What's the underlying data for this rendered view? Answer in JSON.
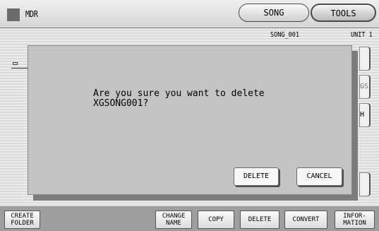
{
  "header": {
    "app_title": "MDR",
    "tabs": [
      {
        "label": "SONG"
      },
      {
        "label": "TOOLS"
      }
    ]
  },
  "info": {
    "song_name": "SONG_001",
    "unit": "UNIT 1"
  },
  "side_buttons": {
    "middle_label": "GS",
    "lower_label": "H"
  },
  "dialog": {
    "message": "Are you sure you want to delete\nXGSONG001?",
    "delete_label": "DELETE",
    "cancel_label": "CANCEL"
  },
  "bottom_buttons": [
    {
      "label": "CREATE\nFOLDER"
    },
    {
      "label": "CHANGE\nNAME"
    },
    {
      "label": "COPY"
    },
    {
      "label": "DELETE"
    },
    {
      "label": "CONVERT"
    },
    {
      "label": "INFOR-\nMATION"
    }
  ]
}
